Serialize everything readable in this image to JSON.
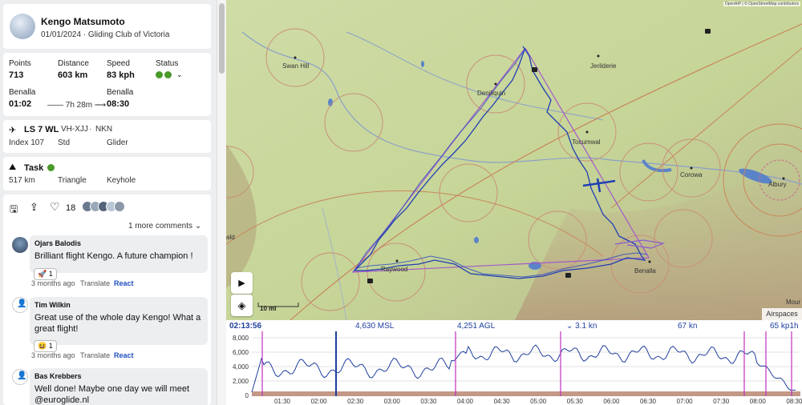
{
  "pilot": {
    "name": "Kengo Matsumoto",
    "date_club": "01/01/2024 · Gliding Club of Victoria"
  },
  "stats": {
    "points_label": "Points",
    "points": "713",
    "distance_label": "Distance",
    "distance": "603 km",
    "speed_label": "Speed",
    "speed": "83 kph",
    "status_label": "Status",
    "start_label": "Benalla",
    "start_time": "01:02",
    "duration": "7h 28m",
    "end_label": "Benalla",
    "end_time": "08:30"
  },
  "aircraft": {
    "type": "LS 7 WL",
    "rego": "VH-XJJ",
    "comp": "NKN",
    "index": "Index 107",
    "class": "Std",
    "kind": "Glider"
  },
  "task": {
    "title": "Task",
    "distance": "517 km",
    "shape": "Triangle",
    "zone": "Keyhole"
  },
  "social": {
    "likes": "18",
    "more_comments": "1 more comments"
  },
  "comments": [
    {
      "author": "Ojars Balodis",
      "text": "Brilliant flight Kengo. A future champion !",
      "reaction_count": "1",
      "reaction_icon": "rocket",
      "age": "3 months ago",
      "translate": "Translate",
      "react": "React"
    },
    {
      "author": "Tim Wilkin",
      "text": "Great use of the whole day Kengo! What a great flight!",
      "reaction_count": "1",
      "reaction_icon": "grin",
      "age": "3 months ago",
      "translate": "Translate",
      "react": "React"
    },
    {
      "author": "Bas Krebbers",
      "text": "Well done! Maybe one day we will meet @euroglide.nl",
      "age": "",
      "translate": "",
      "react": ""
    }
  ],
  "map": {
    "attribution": "OpenAIP | © OpenStreetMap contributors",
    "towns": [
      "Swan Hill",
      "Deniliquin",
      "Jerilderie",
      "Tocumwal",
      "Corowa",
      "Albury",
      "Raywood",
      "Benalla",
      "Mour",
      "ald"
    ],
    "scale": "10 mi",
    "airspaces_label": "Airspaces"
  },
  "barogram": {
    "time": "02:13:56",
    "msl": "4,630 MSL",
    "agl": "4,251 AGL",
    "vario": "3.1 kn",
    "ground_speed": "67 kn",
    "ld": "65 kp1h",
    "y_ticks": [
      "8,000",
      "6,000",
      "4,000",
      "2,000",
      "0"
    ],
    "x_ticks": [
      "01:30",
      "02:00",
      "02:30",
      "03:00",
      "03:30",
      "04:00",
      "04:30",
      "05:00",
      "05:30",
      "06:00",
      "06:30",
      "07:00",
      "07:30",
      "08:00",
      "08:30"
    ]
  },
  "colors": {
    "track": "#1f3fb3",
    "task_line": "#a259c9",
    "accent": "#1f4fbf",
    "status_green": "#4a9a2a"
  }
}
